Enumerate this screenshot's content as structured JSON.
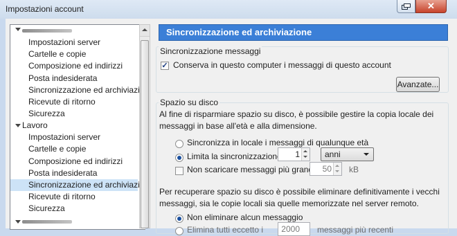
{
  "window": {
    "title": "Impostazioni account",
    "close_glyph": "✕"
  },
  "tree": {
    "items": [
      {
        "label": "Impostazioni server",
        "level": 1
      },
      {
        "label": "Cartelle e copie",
        "level": 1
      },
      {
        "label": "Composizione ed indirizzi",
        "level": 1
      },
      {
        "label": "Posta indesiderata",
        "level": 1
      },
      {
        "label": "Sincronizzazione ed archiviazione",
        "level": 1
      },
      {
        "label": "Ricevute di ritorno",
        "level": 1
      },
      {
        "label": "Sicurezza",
        "level": 1
      },
      {
        "label": "Lavoro",
        "level": 0
      },
      {
        "label": "Impostazioni server",
        "level": 1
      },
      {
        "label": "Cartelle e copie",
        "level": 1
      },
      {
        "label": "Composizione ed indirizzi",
        "level": 1
      },
      {
        "label": "Posta indesiderata",
        "level": 1
      },
      {
        "label": "Sincronizzazione ed archiviazione",
        "level": 1,
        "selected": true
      },
      {
        "label": "Ricevute di ritorno",
        "level": 1
      },
      {
        "label": "Sicurezza",
        "level": 1
      }
    ]
  },
  "pane": {
    "header": "Sincronizzazione ed archiviazione",
    "sync": {
      "legend": "Sincronizzazione messaggi",
      "keep_label": "Conserva in questo computer i messaggi di questo account",
      "keep_checked": true,
      "advanced_button": "Avanzate..."
    },
    "disk": {
      "legend": "Spazio su disco",
      "intro": "Al fine di risparmiare spazio su disco, è possibile gestire la copia locale dei messaggi in base all'età e alla dimensione.",
      "opt_all": "Sincronizza in locale i messaggi di qualunque età",
      "opt_limit": "Limita la sincronizzazione a",
      "limit_value": "1",
      "limit_unit": "anni",
      "no_download_label": "Non scaricare messaggi più grandi di",
      "no_download_value": "50",
      "no_download_unit": "kB",
      "delete_intro": "Per recuperare spazio su disco è possibile eliminare definitivamente i vecchi messaggi, sia le copie locali sia quelle memorizzate nel server remoto.",
      "opt_keep_all": "Non eliminare alcun messaggio",
      "opt_delete_partial": "Elimina tutti eccetto i",
      "delete_value": "2000",
      "delete_unit": "messaggi più recenti"
    }
  }
}
